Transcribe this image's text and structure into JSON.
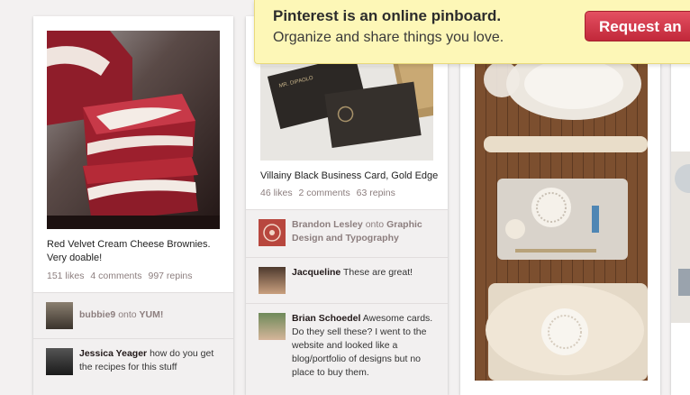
{
  "notice": {
    "headline": "Pinterest is an online pinboard.",
    "subline": "Organize and share things you love.",
    "button_label": "Request an"
  },
  "pins": [
    {
      "image": "red-velvet-brownies-photo",
      "description": "Red Velvet Cream Cheese Brownies. Very doable!",
      "likes": "151 likes",
      "comments": "4 comments",
      "repins": "997 repins",
      "activity": [
        {
          "user": "bubbie9",
          "onto": "onto",
          "board": "YUM!"
        },
        {
          "user": "Jessica Yeager",
          "text": "how do you get the recipes for this stuff"
        }
      ]
    },
    {
      "image": "business-cards-photo",
      "description": "Villainy Black Business Card, Gold Edge",
      "likes": "46 likes",
      "comments": "2 comments",
      "repins": "63 repins",
      "card_text": "MR. DIPAOLO",
      "activity": [
        {
          "user": "Brandon Lesley",
          "onto": "onto",
          "board": "Graphic Design and Typography"
        },
        {
          "user": "Jacqueline",
          "text": "These are great!"
        },
        {
          "user": "Brian Schoedel",
          "text": "Awesome cards. Do they sell these? I went to the website and looked like a blog/portfolio of designs but no place to buy them."
        }
      ]
    },
    {
      "image": "ceramic-doily-craft-photo"
    }
  ],
  "colors": {
    "background": "#f3f1f1",
    "notice": "#fdf7b7",
    "button": "#cb2d3e",
    "muted_text": "#8c7e7e"
  }
}
